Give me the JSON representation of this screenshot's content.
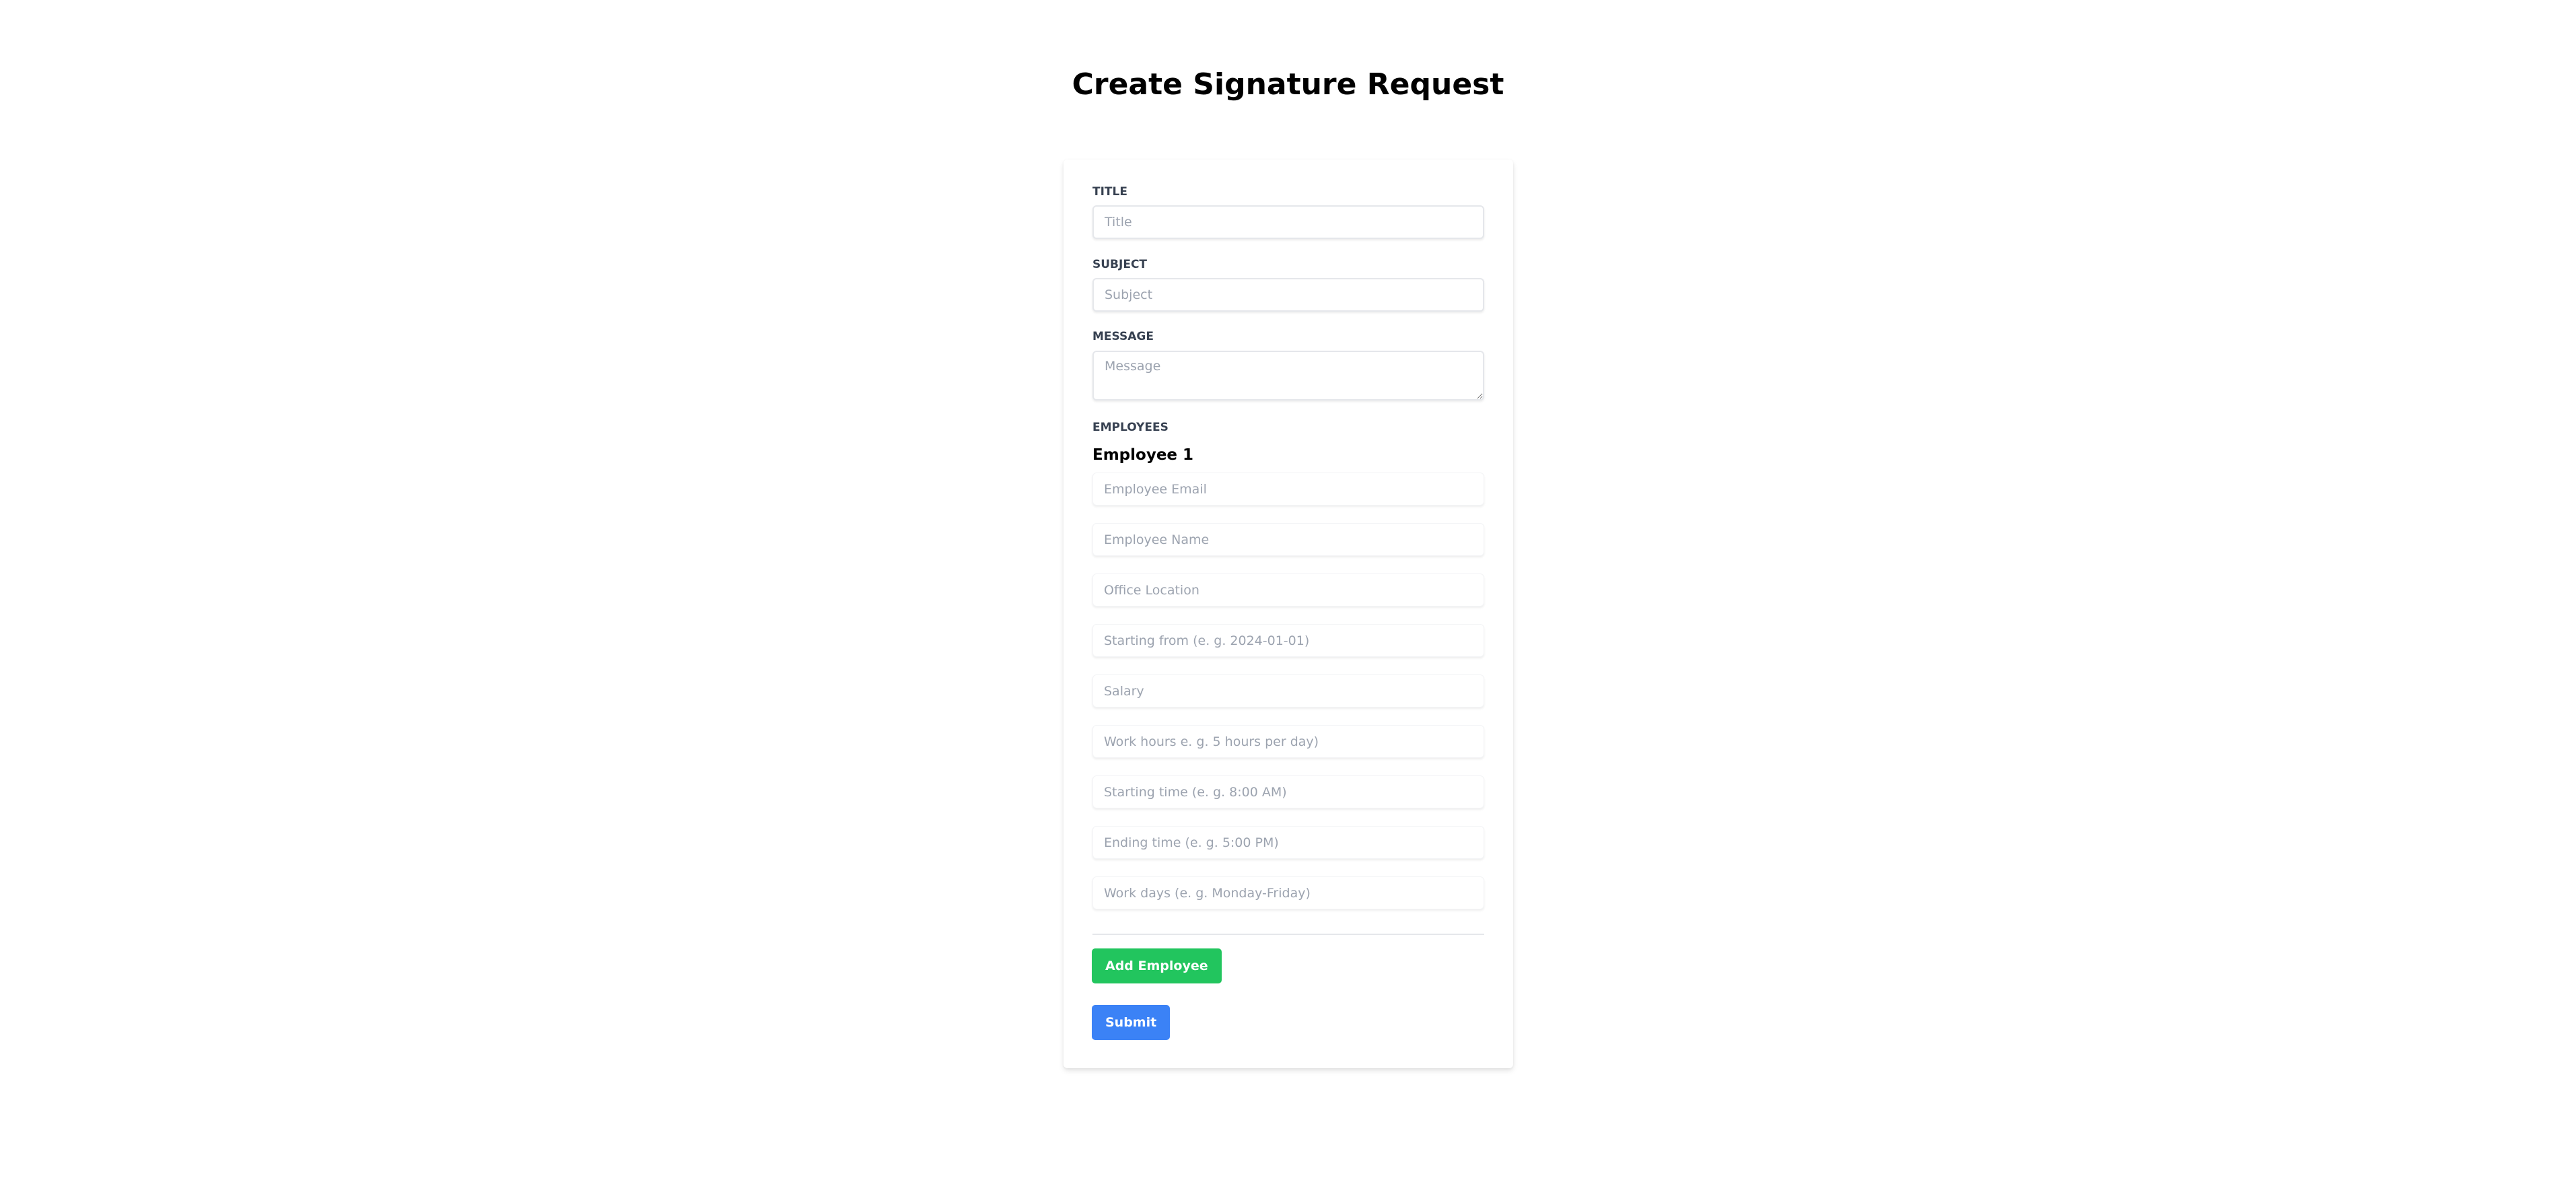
{
  "page": {
    "title": "Create Signature Request"
  },
  "form": {
    "title": {
      "label": "TITLE",
      "placeholder": "Title",
      "value": ""
    },
    "subject": {
      "label": "SUBJECT",
      "placeholder": "Subject",
      "value": ""
    },
    "message": {
      "label": "MESSAGE",
      "placeholder": "Message",
      "value": ""
    },
    "employees_label": "EMPLOYEES",
    "employees": [
      {
        "heading": "Employee 1",
        "fields": {
          "email": {
            "placeholder": "Employee Email",
            "value": ""
          },
          "name": {
            "placeholder": "Employee Name",
            "value": ""
          },
          "office_location": {
            "placeholder": "Office Location",
            "value": ""
          },
          "starting_from": {
            "placeholder": "Starting from (e. g. 2024-01-01)",
            "value": ""
          },
          "salary": {
            "placeholder": "Salary",
            "value": ""
          },
          "work_hours": {
            "placeholder": "Work hours e. g. 5 hours per day)",
            "value": ""
          },
          "starting_time": {
            "placeholder": "Starting time (e. g. 8:00 AM)",
            "value": ""
          },
          "ending_time": {
            "placeholder": "Ending time (e. g. 5:00 PM)",
            "value": ""
          },
          "work_days": {
            "placeholder": "Work days (e. g. Monday-Friday)",
            "value": ""
          }
        }
      }
    ],
    "buttons": {
      "add_employee": "Add Employee",
      "submit": "Submit"
    }
  },
  "colors": {
    "add_button": "#22c55e",
    "submit_button": "#3b82f6",
    "label_text": "#374151",
    "placeholder_text": "#9ca3af"
  }
}
